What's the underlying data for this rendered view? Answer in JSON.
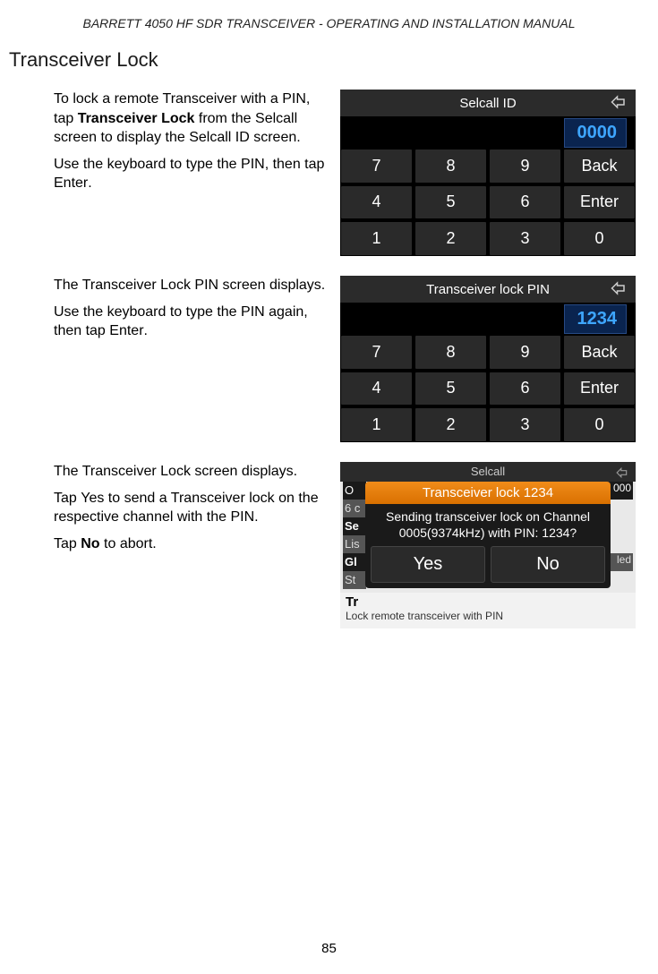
{
  "doc_header": "BARRETT 4050 HF SDR TRANSCEIVER - OPERATING AND INSTALLATION MANUAL",
  "section_title": "Transceiver Lock",
  "page_number": "85",
  "block1": {
    "p1_a": "To lock a remote Transceiver with a PIN, tap ",
    "p1_b": "Transceiver Lock",
    "p1_c": " from the Selcall screen to display the Selcall ID screen.",
    "p2_a": "Use the keyboard to type the PIN, then tap ",
    "p2_b": "Enter",
    "p2_c": "."
  },
  "block2": {
    "p1": "The Transceiver Lock PIN screen displays.",
    "p2_a": "Use the keyboard to type the PIN again, then tap ",
    "p2_b": "Enter",
    "p2_c": "."
  },
  "block3": {
    "p1": "The Transceiver Lock screen displays.",
    "p2_a": "Tap ",
    "p2_b": "Yes",
    "p2_c": " to send a Transceiver lock on the respective channel with the PIN.",
    "p3_a": "Tap ",
    "p3_b": "No",
    "p3_c": " to abort."
  },
  "keypad1": {
    "title": "Selcall ID",
    "value": "0000",
    "keys": [
      "7",
      "8",
      "9",
      "Back",
      "4",
      "5",
      "6",
      "Enter",
      "1",
      "2",
      "3",
      "0"
    ]
  },
  "keypad2": {
    "title": "Transceiver lock PIN",
    "value": "1234",
    "keys": [
      "7",
      "8",
      "9",
      "Back",
      "4",
      "5",
      "6",
      "Enter",
      "1",
      "2",
      "3",
      "0"
    ]
  },
  "confirm": {
    "bg_title": "Selcall",
    "bg_left": [
      "O",
      "6 c",
      "Se",
      "Lis",
      "Gl",
      "St",
      "Tr"
    ],
    "bg_right_top": "000",
    "bg_right_mid": "led",
    "dialog_title": "Transceiver lock 1234",
    "dialog_body": "Sending transceiver lock on Channel 0005(9374kHz) with PIN: 1234?",
    "yes": "Yes",
    "no": "No",
    "bottom_tr": "Tr",
    "bottom_desc": "Lock remote transceiver with PIN"
  }
}
